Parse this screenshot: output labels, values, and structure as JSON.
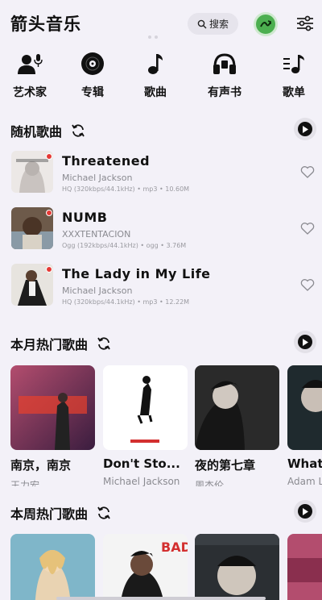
{
  "app": {
    "title": "箭头音乐"
  },
  "search": {
    "label": "搜索",
    "icon": "search-icon"
  },
  "categories": [
    {
      "label": "艺术家",
      "icon": "artist-mic-icon"
    },
    {
      "label": "专辑",
      "icon": "disc-icon"
    },
    {
      "label": "歌曲",
      "icon": "music-note-icon"
    },
    {
      "label": "有声书",
      "icon": "headphones-icon"
    },
    {
      "label": "歌单",
      "icon": "playlist-icon"
    }
  ],
  "random_songs": {
    "title": "随机歌曲",
    "items": [
      {
        "name": "Threatened",
        "artist": "Michael Jackson",
        "meta": "HQ (320kbps/44.1kHz) • mp3 • 10.60M"
      },
      {
        "name": "NUMB",
        "artist": "XXXTENTACION",
        "meta": "Ogg (192kbps/44.1kHz) • ogg • 3.76M"
      },
      {
        "name": "The Lady in My Life",
        "artist": "Michael Jackson",
        "meta": "HQ (320kbps/44.1kHz) • mp3 • 12.22M"
      }
    ]
  },
  "monthly_hot": {
    "title": "本月热门歌曲",
    "items": [
      {
        "title": "南京，南京",
        "artist": "王力宏"
      },
      {
        "title": "Don't Sto...",
        "artist": "Michael Jackson"
      },
      {
        "title": "夜的第七章",
        "artist": "周杰伦"
      },
      {
        "title": "What",
        "artist": "Adam L"
      }
    ]
  },
  "weekly_hot": {
    "title": "本周热门歌曲"
  },
  "colors": {
    "accent_green": "#4caf50",
    "badge_red": "#e53935",
    "background": "#f3f1f8"
  }
}
